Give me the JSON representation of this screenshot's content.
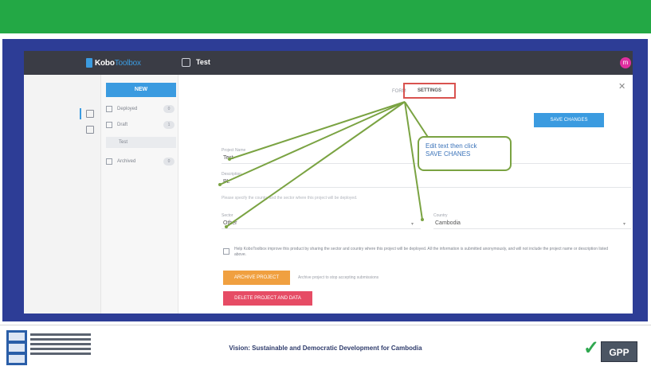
{
  "app": {
    "logo_primary": "Kobo",
    "logo_accent": "Toolbox",
    "project_name": "Test",
    "avatar_initial": "m"
  },
  "sidebar": {
    "new_label": "NEW",
    "items": [
      {
        "label": "Deployed",
        "count": "0"
      },
      {
        "label": "Draft",
        "count": "1"
      },
      {
        "label": "Archived",
        "count": "0"
      }
    ],
    "sub_item": "Test"
  },
  "tabs": {
    "form": "FORM",
    "settings": "SETTINGS"
  },
  "buttons": {
    "save": "SAVE CHANGES",
    "archive": "ARCHIVE PROJECT",
    "delete": "DELETE PROJECT AND DATA"
  },
  "fields": {
    "project_name_label": "Project Name",
    "project_name_value": "Test",
    "description_label": "Description",
    "description_value": "PL",
    "help_text": "Please specify the country and the sector where this project will be deployed.",
    "sector_label": "Sector",
    "sector_value": "Other",
    "country_label": "Country",
    "country_value": "Cambodia"
  },
  "consent_text": "Help KoboToolbox improve this product by sharing the sector and country where this project will be deployed. All the information is submitted anonymously, and will not include the project name or description listed above.",
  "archive_note": "Archive project to stop accepting submissions",
  "callout": {
    "line1": "Edit text then click",
    "line2": "SAVE CHANES"
  },
  "footer": {
    "vision": "Vision: Sustainable and Democratic Development for Cambodia",
    "gpp_label": "GPP"
  },
  "colors": {
    "top_band": "#23a845",
    "frame": "#2d3d96",
    "primary": "#3b9be0",
    "archive": "#f0a040",
    "delete": "#e64c65",
    "annotation": "#7aa342",
    "highlight": "#d9534f"
  }
}
